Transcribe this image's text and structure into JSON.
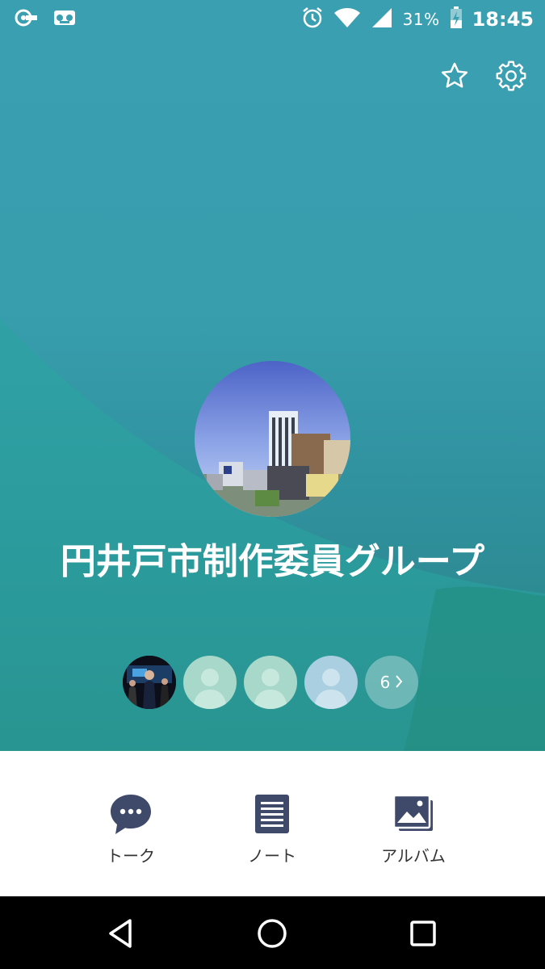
{
  "status_bar": {
    "battery_percent": "31%",
    "time": "18:45",
    "icons": [
      "line-notification-icon",
      "voicemail-icon",
      "alarm-icon",
      "wifi-icon",
      "cell-signal-icon",
      "battery-charging-icon"
    ]
  },
  "header": {
    "actions": [
      "favorite-star-icon",
      "settings-gear-icon"
    ]
  },
  "group": {
    "title": "円井戸市制作委員グループ",
    "more_members_count": "6"
  },
  "tabs": [
    {
      "label": "トーク",
      "icon": "chat-bubble-icon"
    },
    {
      "label": "ノート",
      "icon": "note-icon"
    },
    {
      "label": "アルバム",
      "icon": "album-icon"
    }
  ],
  "colors": {
    "hero_top": "#3a9fb0",
    "hero_bottom": "#27817f",
    "icon_navy": "#3f4a6b",
    "member_placeholder": "#a8d8c9",
    "member_placeholder_blue": "#a9cfe0"
  }
}
